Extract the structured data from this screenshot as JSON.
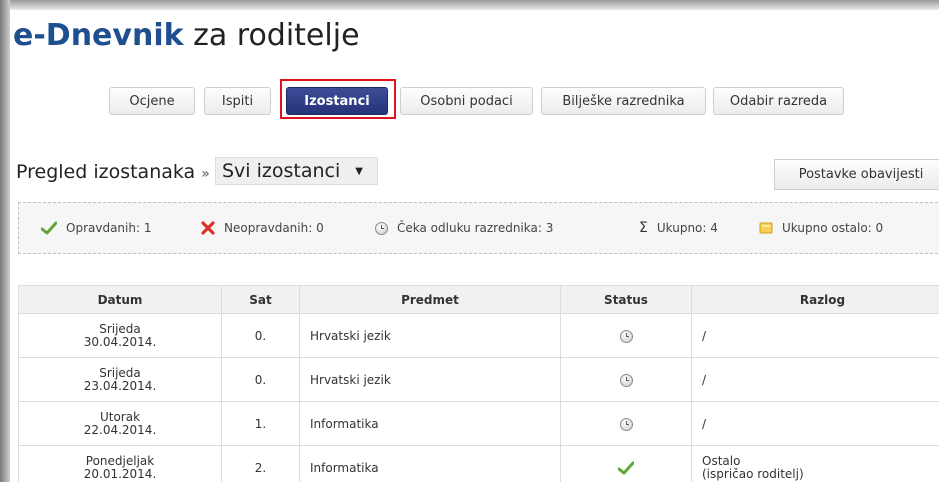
{
  "app": {
    "brand": "e-Dnevnik",
    "suffix": " za roditelje"
  },
  "tabs": [
    {
      "label": "Ocjene"
    },
    {
      "label": "Ispiti"
    },
    {
      "label": "Izostanci"
    },
    {
      "label": "Osobni podaci"
    },
    {
      "label": "Bilješke razrednika"
    },
    {
      "label": "Odabir razreda"
    }
  ],
  "section": {
    "title": "Pregled izostanaka",
    "separator": "»",
    "filter_value": "Svi izostanci",
    "settings_label": "Postavke obavijesti"
  },
  "summary": {
    "excused_label": "Opravdanih: 1",
    "unexcused_label": "Neopravdanih: 0",
    "pending_label": "Čeka odluku razrednika: 3",
    "total_label": "Ukupno: 4",
    "other_label": "Ukupno ostalo: 0"
  },
  "table": {
    "headers": [
      "Datum",
      "Sat",
      "Predmet",
      "Status",
      "Razlog"
    ],
    "rows": [
      {
        "day": "Srijeda",
        "date": "30.04.2014.",
        "period": "0.",
        "subject": "Hrvatski jezik",
        "status_icon": "clock-icon",
        "reason": "/",
        "reason_note": ""
      },
      {
        "day": "Srijeda",
        "date": "23.04.2014.",
        "period": "0.",
        "subject": "Hrvatski jezik",
        "status_icon": "clock-icon",
        "reason": "/",
        "reason_note": ""
      },
      {
        "day": "Utorak",
        "date": "22.04.2014.",
        "period": "1.",
        "subject": "Informatika",
        "status_icon": "clock-icon",
        "reason": "/",
        "reason_note": ""
      },
      {
        "day": "Ponedjeljak",
        "date": "20.01.2014.",
        "period": "2.",
        "subject": "Informatika",
        "status_icon": "checkmark-icon",
        "reason": "Ostalo",
        "reason_note": "(ispričao roditelj)"
      }
    ]
  },
  "colors": {
    "brand": "#1e4f8f",
    "active_tab": "#2e3d85",
    "highlight": "#e0121b",
    "check": "#5fa837",
    "cross": "#d9302c"
  }
}
